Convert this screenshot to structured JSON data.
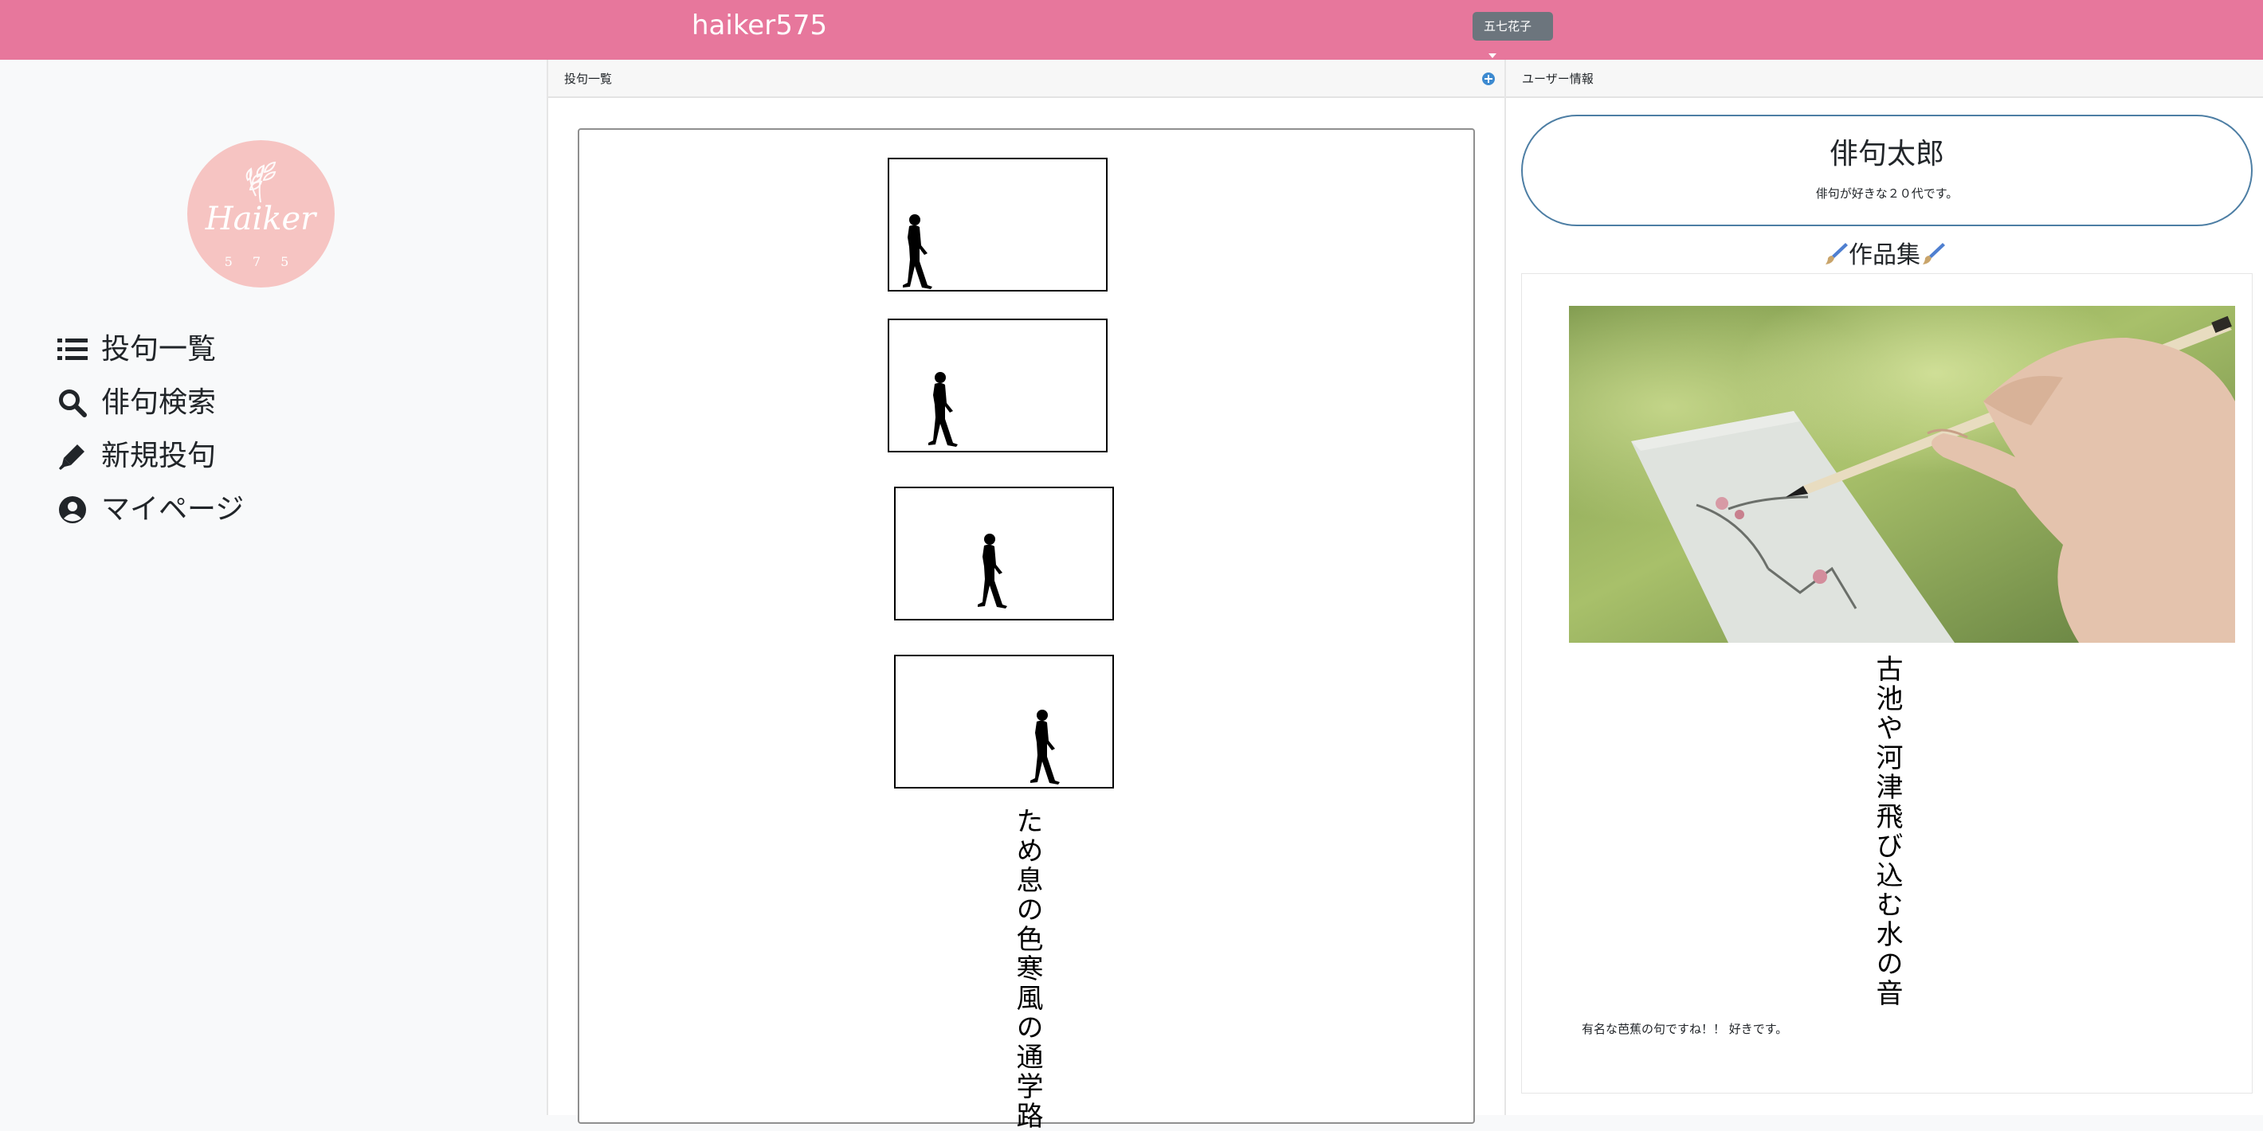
{
  "header": {
    "brand": "haiker575",
    "user_menu_label": "五七花子",
    "bg_color": "#e7779c"
  },
  "sidebar": {
    "logo": {
      "text": "Haiker",
      "sub": "5 7 5",
      "bg_color": "#f6c4c2"
    },
    "items": [
      {
        "icon": "list-icon",
        "label": "投句一覧"
      },
      {
        "icon": "search-icon",
        "label": "俳句検索"
      },
      {
        "icon": "pen-icon",
        "label": "新規投句"
      },
      {
        "icon": "user-circle-icon",
        "label": "マイページ"
      }
    ]
  },
  "posts": {
    "title": "投句一覧",
    "add_icon": "plus-circle-icon",
    "frames_icon": "walking-person-icon",
    "haiku": "ため息の色寒風の通学路"
  },
  "user_info": {
    "title": "ユーザー情報",
    "name": "俳句太郎",
    "bio": "俳句が好きな２０代です。",
    "works_title": "作品集",
    "works_title_icon": "paintbrush-icon",
    "work": {
      "image": "brush-writing-photo",
      "haiku": "古池や河津飛び込む水の音",
      "comment": "有名な芭蕉の句ですね！！ 好きです。"
    }
  }
}
